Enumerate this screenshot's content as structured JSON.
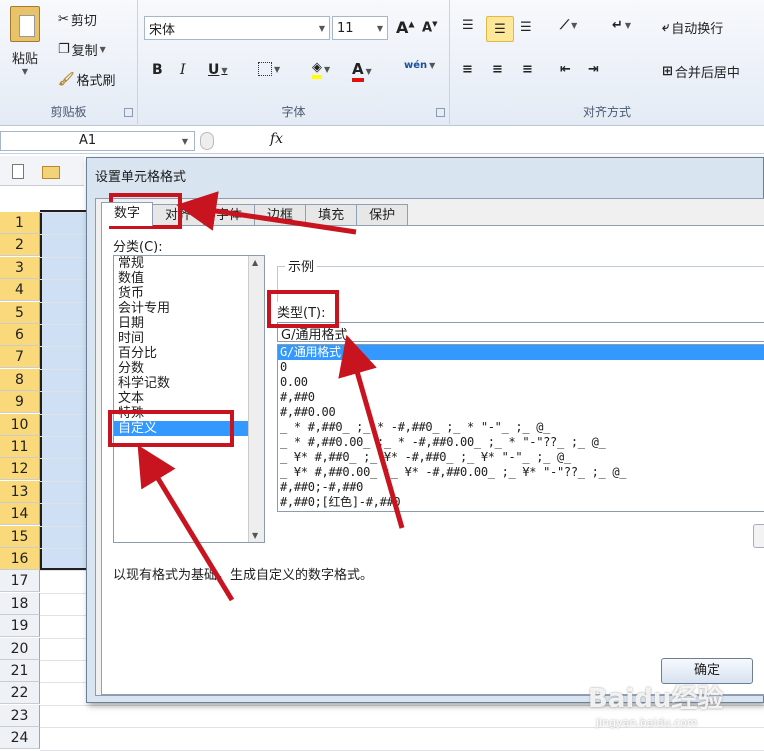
{
  "ribbon": {
    "clipboard": {
      "label": "剪贴板",
      "paste": "粘贴",
      "cut": "剪切",
      "copy": "复制",
      "format_painter": "格式刷"
    },
    "font": {
      "label": "字体",
      "font_name": "宋体",
      "font_size": "11",
      "bold": "B",
      "italic": "I",
      "underline": "U",
      "font_color_letter": "A",
      "phonetic": "wén"
    },
    "alignment": {
      "label": "对齐方式",
      "wrap_text": "自动换行",
      "merge_center": "合并后居中"
    }
  },
  "formula_bar": {
    "name_box": "A1",
    "fx": "fx"
  },
  "sheet": {
    "rows": [
      "1",
      "2",
      "3",
      "4",
      "5",
      "6",
      "7",
      "8",
      "9",
      "10",
      "11",
      "12",
      "13",
      "14",
      "15",
      "16",
      "17",
      "18",
      "19",
      "20",
      "21",
      "22",
      "23",
      "24"
    ],
    "selected_rows": 16
  },
  "dialog": {
    "title": "设置单元格格式",
    "tabs": [
      "数字",
      "对齐",
      "字体",
      "边框",
      "填充",
      "保护"
    ],
    "active_tab": "数字",
    "category_label": "分类(C):",
    "categories": [
      "常规",
      "数值",
      "货币",
      "会计专用",
      "日期",
      "时间",
      "百分比",
      "分数",
      "科学记数",
      "文本",
      "特殊",
      "自定义"
    ],
    "selected_category": "自定义",
    "sample_label": "示例",
    "type_label": "类型(T):",
    "type_value": "G/通用格式",
    "formats": [
      "G/通用格式",
      "0",
      "0.00",
      "#,##0",
      "#,##0.00",
      "_ * #,##0_ ;_ * -#,##0_ ;_ * \"-\"_ ;_ @_ ",
      "_ * #,##0.00_ ;_ * -#,##0.00_ ;_ * \"-\"??_ ;_ @_ ",
      "_ ¥* #,##0_ ;_ ¥* -#,##0_ ;_ ¥* \"-\"_ ;_ @_ ",
      "_ ¥* #,##0.00_ ;_ ¥* -#,##0.00_ ;_ ¥* \"-\"??_ ;_ @_ ",
      "#,##0;-#,##0",
      "#,##0;[红色]-#,##0"
    ],
    "description": "以现有格式为基础，生成自定义的数字格式。",
    "ok_button": "确定"
  },
  "watermark": {
    "brand": "Baidu经验",
    "url": "jingyan.baidu.com"
  },
  "colors": {
    "annotation": "#c8141e",
    "selection": "#3399ff"
  }
}
